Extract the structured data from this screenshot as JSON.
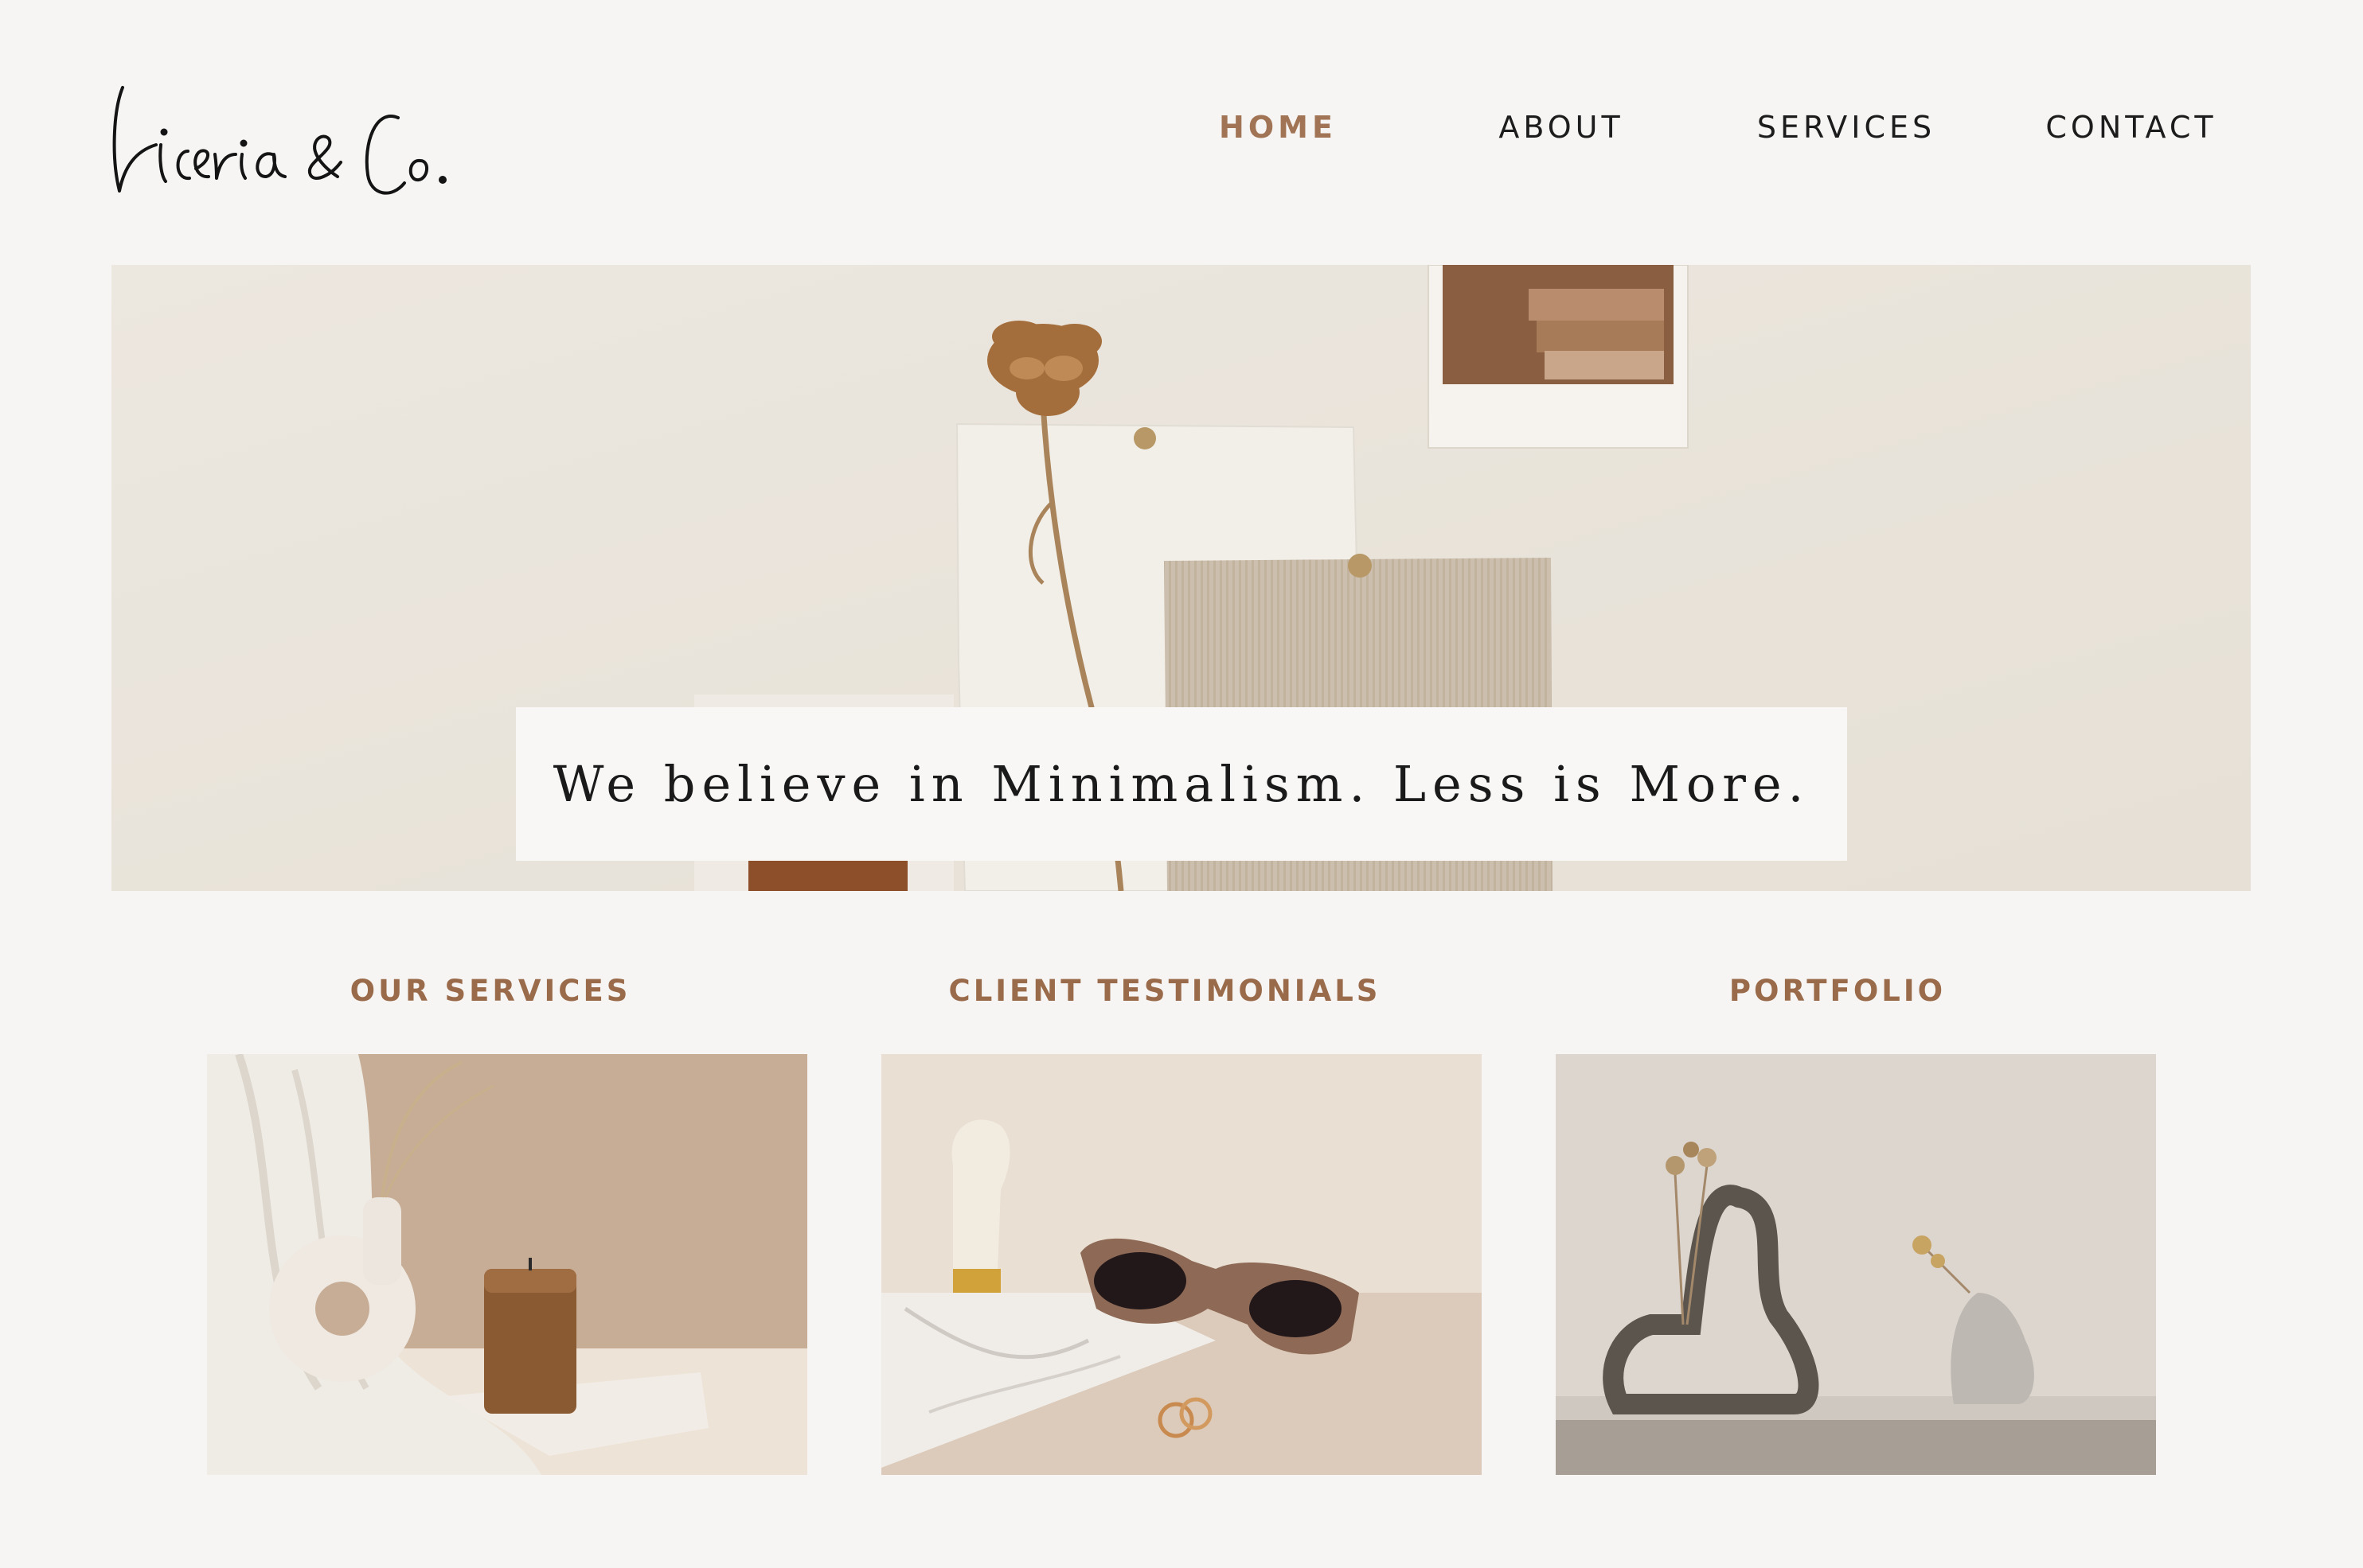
{
  "brand": {
    "logo_text": "Liceria & Co."
  },
  "nav": {
    "items": [
      {
        "label": "HOME",
        "active": true
      },
      {
        "label": "ABOUT",
        "active": false
      },
      {
        "label": "SERVICES",
        "active": false
      },
      {
        "label": "CONTACT",
        "active": false
      }
    ]
  },
  "hero": {
    "tagline": "We believe in Minimalism. Less is More."
  },
  "sections": [
    {
      "title": "OUR SERVICES"
    },
    {
      "title": "CLIENT TESTIMONIALS"
    },
    {
      "title": "PORTFOLIO"
    }
  ],
  "colors": {
    "background": "#f7f5f3",
    "accent": "#a07454",
    "nav_text": "#1c1c1c"
  }
}
